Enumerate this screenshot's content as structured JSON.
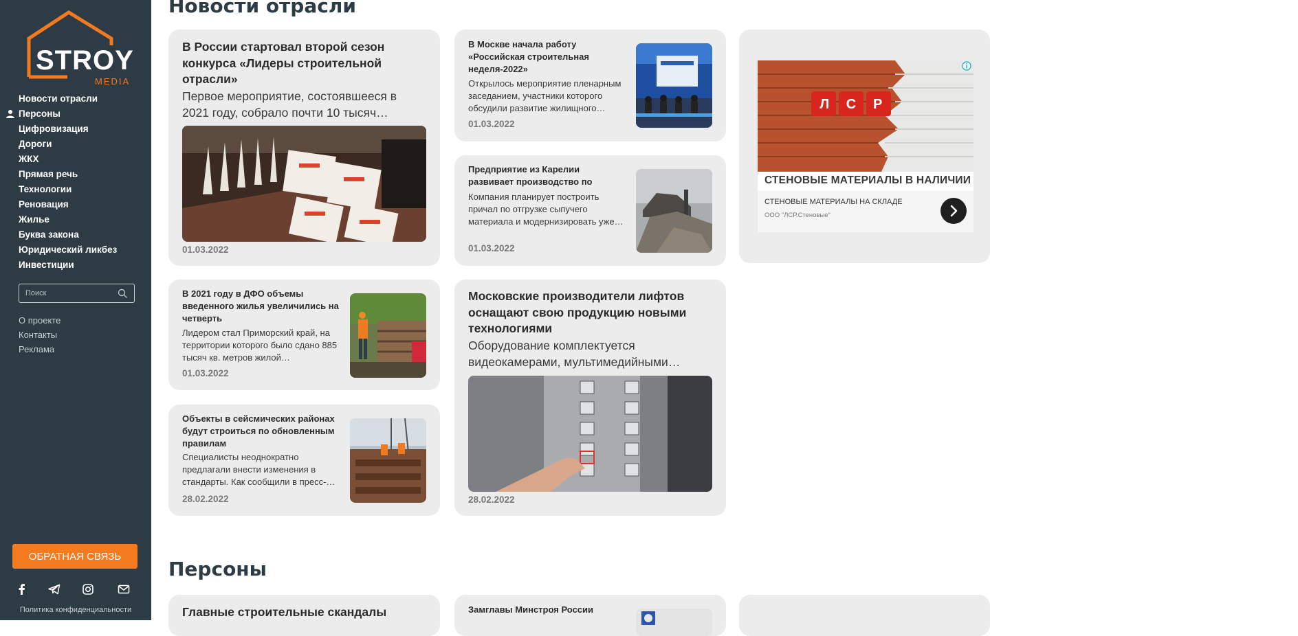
{
  "brand": {
    "name": "STROY",
    "sub": "MEDIA"
  },
  "nav": [
    "Новости отрасли",
    "Персоны",
    "Цифровизация",
    "Дороги",
    "ЖКХ",
    "Прямая речь",
    "Технологии",
    "Реновация",
    "Жилье",
    "Буква закона",
    "Юридический ликбез",
    "Инвестиции"
  ],
  "search": {
    "placeholder": "Поиск"
  },
  "secondary_links": [
    "О проекте",
    "Контакты",
    "Реклама"
  ],
  "feedback_label": "ОБРАТНАЯ СВЯЗЬ",
  "privacy": "Политика конфиденциальности",
  "sections": {
    "news_title": "Новости отрасли",
    "persons_title": "Персоны"
  },
  "cards": {
    "c1": {
      "title": "В России стартовал второй сезон конкурса «Лидеры строительной отрасли»",
      "lead": "Первое мероприятие, состоявшееся в 2021 году, собрало почти 10 тысяч…",
      "date": "01.03.2022"
    },
    "c2": {
      "title": "В Москве начала работу «Российская строительная неделя-2022»",
      "lead": "Открылось мероприятие пленарным заседанием, участники которого обсудили развитие жилищного…",
      "date": "01.03.2022"
    },
    "c3": {
      "title": "Предприятие из Карелии развивает производство по выпуску щебня",
      "lead": "Компания планирует построить причал по отгрузке сыпучего материала и модернизировать уже…",
      "date": "01.03.2022"
    },
    "c4": {
      "title": "В 2021 году в ДФО объемы введенного жилья увеличились на четверть",
      "lead": "Лидером стал Приморский край, на территории которого было сдано 885 тысяч кв. метров жилой…",
      "date": "01.03.2022"
    },
    "c5": {
      "title": "Московские производители лифтов оснащают свою продукцию новыми технологиями",
      "lead": "Оборудование комплектуется видеокамерами, мультимедийными…",
      "date": "28.02.2022"
    },
    "c6": {
      "title": "Объекты в сейсмических районах будут строиться по обновленным правилам",
      "lead": "Специалисты неоднократно предлагали внести изменения в стандарты. Как сообщили в пресс-…",
      "date": "28.02.2022"
    },
    "p1": {
      "title": "Главные строительные скандалы России."
    },
    "p2": {
      "title": "Замглавы Минстроя России"
    }
  },
  "ad": {
    "brand": "ЛСР",
    "headline": "СТЕНОВЫЕ МАТЕРИАЛЫ В НАЛИЧИИ",
    "text": "СТЕНОВЫЕ МАТЕРИАЛЫ НА СКЛАДЕ",
    "company": "ООО \"ЛСР.Стеновые\""
  },
  "colors": {
    "sidebar": "#2d3b44",
    "accent": "#f47a20",
    "card": "#ececec"
  }
}
